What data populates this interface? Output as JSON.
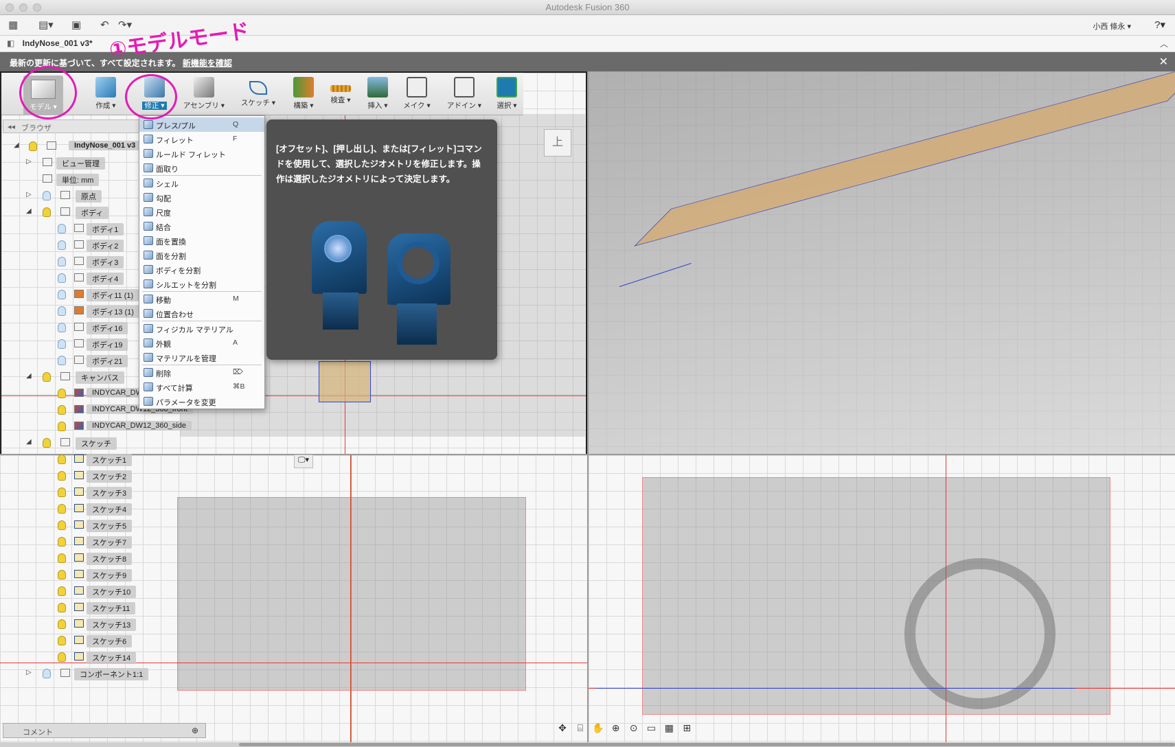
{
  "window": {
    "title": "Autodesk Fusion 360"
  },
  "apptoolbar": {
    "user": "小西 條永 ▾",
    "help": "?▾"
  },
  "document": {
    "tab": "IndyNose_001 v3*"
  },
  "notification": {
    "message": "最新の更新に基づいて、すべて設定されます。",
    "link": "新機能を確認",
    "close": "✕"
  },
  "ribbon": {
    "workspace": "モデル ▾",
    "buttons": [
      {
        "label": "作成 ▾"
      },
      {
        "label": "修正 ▾"
      },
      {
        "label": "アセンブリ ▾"
      },
      {
        "label": "スケッチ ▾"
      },
      {
        "label": "構築 ▾"
      },
      {
        "label": "検査 ▾"
      },
      {
        "label": "挿入 ▾"
      },
      {
        "label": "メイク ▾"
      },
      {
        "label": "アドイン ▾"
      },
      {
        "label": "選択 ▾"
      }
    ]
  },
  "browser": {
    "header": "ブラウザ",
    "root": "IndyNose_001 v3",
    "items": {
      "view_mgmt": "ビュー管理",
      "units": "単位: mm",
      "origin": "原点",
      "bodies": "ボディ",
      "canvases": "キャンバス",
      "sketches": "スケッチ",
      "component": "コンポーネント1:1"
    },
    "body_list": [
      "ボディ1",
      "ボディ2",
      "ボディ3",
      "ボディ4",
      "ボディ11 (1)",
      "ボディ13 (1)",
      "ボディ16",
      "ボディ19",
      "ボディ21"
    ],
    "canvas_list": [
      "INDYCAR_DW",
      "INDYCAR_DW12_360_front",
      "INDYCAR_DW12_360_side"
    ],
    "sketch_list": [
      "スケッチ1",
      "スケッチ2",
      "スケッチ3",
      "スケッチ4",
      "スケッチ5",
      "スケッチ7",
      "スケッチ8",
      "スケッチ9",
      "スケッチ10",
      "スケッチ11",
      "スケッチ13",
      "スケッチ6",
      "スケッチ14"
    ]
  },
  "modify_menu": {
    "close": "✕",
    "items": [
      {
        "label": "プレス/プル",
        "key": "Q"
      },
      {
        "label": "フィレット",
        "key": "F"
      },
      {
        "label": "ルールド フィレット",
        "key": ""
      },
      {
        "label": "面取り",
        "key": ""
      },
      {
        "label": "シェル",
        "key": ""
      },
      {
        "label": "勾配",
        "key": ""
      },
      {
        "label": "尺度",
        "key": ""
      },
      {
        "label": "結合",
        "key": ""
      },
      {
        "label": "面を置換",
        "key": ""
      },
      {
        "label": "面を分割",
        "key": ""
      },
      {
        "label": "ボディを分割",
        "key": ""
      },
      {
        "label": "シルエットを分割",
        "key": ""
      },
      {
        "label": "移動",
        "key": "M"
      },
      {
        "label": "位置合わせ",
        "key": ""
      },
      {
        "label": "フィジカル マテリアル",
        "key": ""
      },
      {
        "label": "外観",
        "key": "A"
      },
      {
        "label": "マテリアルを管理",
        "key": ""
      },
      {
        "label": "削除",
        "key": "⌦"
      },
      {
        "label": "すべて計算",
        "key": "⌘B"
      },
      {
        "label": "パラメータを変更",
        "key": ""
      }
    ]
  },
  "tooltip": {
    "text": "[オフセット]、[押し出し]、または[フィレット]コマンドを使用して、選択したジオメトリを修正します。操作は選択したジオメトリによって決定します。"
  },
  "viewcube": {
    "label": "上"
  },
  "annotation": {
    "text": "①モデルモード"
  },
  "comment": {
    "label": "コメント",
    "add": "⊕"
  },
  "colors": {
    "accent": "#1d7bb0",
    "annotation": "#e31bb5",
    "sketch_line": "#3344cc",
    "axis_red": "#e33333"
  }
}
